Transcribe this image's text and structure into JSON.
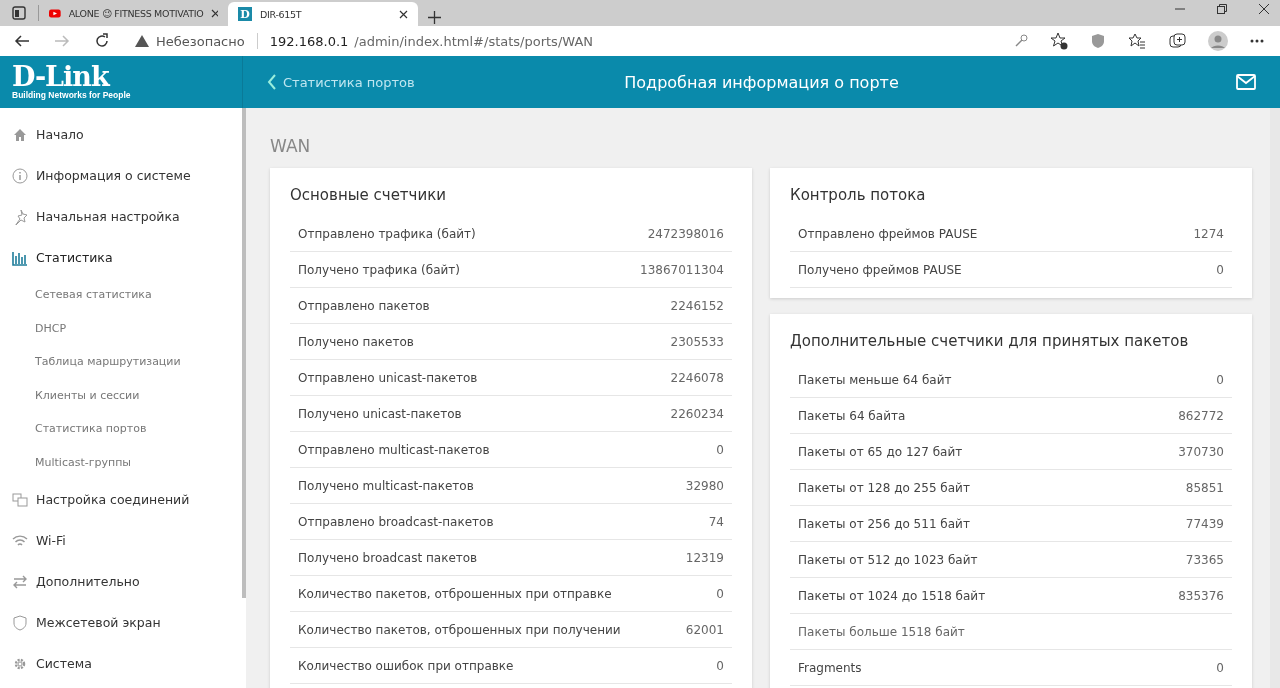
{
  "browser": {
    "tabs": [
      {
        "title": "ALONE 😉 FITNESS MOTIVATIO",
        "selected": false
      },
      {
        "title": "DIR-615T",
        "favicon": "D",
        "selected": true
      }
    ],
    "address": {
      "security": "Небезопасно",
      "host": "192.168.0.1",
      "path": "/admin/index.html#/stats/ports/WAN"
    }
  },
  "header": {
    "logo": "D-Link",
    "tagline": "Building Networks for People",
    "back": "Статистика портов",
    "title": "Подробная информация о порте"
  },
  "sidebar": {
    "items": [
      {
        "label": "Начало",
        "selected": false
      },
      {
        "label": "Информация о системе",
        "selected": false
      },
      {
        "label": "Начальная настройка",
        "selected": false
      },
      {
        "label": "Статистика",
        "selected": true,
        "children": [
          {
            "label": "Сетевая статистика"
          },
          {
            "label": "DHCP"
          },
          {
            "label": "Таблица маршрутизации"
          },
          {
            "label": "Клиенты и сессии"
          },
          {
            "label": "Статистика портов"
          },
          {
            "label": "Multicast-группы"
          }
        ]
      },
      {
        "label": "Настройка соединений",
        "selected": false
      },
      {
        "label": "Wi-Fi",
        "selected": false
      },
      {
        "label": "Дополнительно",
        "selected": false
      },
      {
        "label": "Межсетевой экран",
        "selected": false
      },
      {
        "label": "Система",
        "selected": false
      }
    ]
  },
  "page_title": "WAN",
  "cards": [
    {
      "title": "Основные счетчики",
      "rows": [
        {
          "label": "Отправлено трафика (байт)",
          "value": "2472398016"
        },
        {
          "label": "Получено трафика (байт)",
          "value": "13867011304"
        },
        {
          "label": "Отправлено пакетов",
          "value": "2246152"
        },
        {
          "label": "Получено пакетов",
          "value": "2305533"
        },
        {
          "label": "Отправлено unicast-пакетов",
          "value": "2246078"
        },
        {
          "label": "Получено unicast-пакетов",
          "value": "2260234"
        },
        {
          "label": "Отправлено multicast-пакетов",
          "value": "0"
        },
        {
          "label": "Получено multicast-пакетов",
          "value": "32980"
        },
        {
          "label": "Отправлено broadcast-пакетов",
          "value": "74"
        },
        {
          "label": "Получено broadcast пакетов",
          "value": "12319"
        },
        {
          "label": "Количество пакетов, отброшенных при отправке",
          "value": "0"
        },
        {
          "label": "Количество пакетов, отброшенных при получении",
          "value": "62001"
        },
        {
          "label": "Количество ошибок при отправке",
          "value": "0"
        }
      ]
    },
    {
      "title": "Контроль потока",
      "rows": [
        {
          "label": "Отправлено фреймов PAUSE",
          "value": "1274"
        },
        {
          "label": "Получено фреймов PAUSE",
          "value": "0"
        }
      ]
    },
    {
      "title": "Дополнительные счетчики для принятых пакетов",
      "rows": [
        {
          "label": "Пакеты меньше 64 байт",
          "value": "0"
        },
        {
          "label": "Пакеты 64 байта",
          "value": "862772"
        },
        {
          "label": "Пакеты от 65 до 127 байт",
          "value": "370730"
        },
        {
          "label": "Пакеты от 128 до 255 байт",
          "value": "85851"
        },
        {
          "label": "Пакеты от 256 до 511 байт",
          "value": "77439"
        },
        {
          "label": "Пакеты от 512 до 1023 байт",
          "value": "73365"
        },
        {
          "label": "Пакеты от 1024 до 1518 байт",
          "value": "835376"
        },
        {
          "label": "Пакеты больше 1518 байт"
        },
        {
          "label": "Fragments",
          "value": "0"
        }
      ]
    }
  ]
}
